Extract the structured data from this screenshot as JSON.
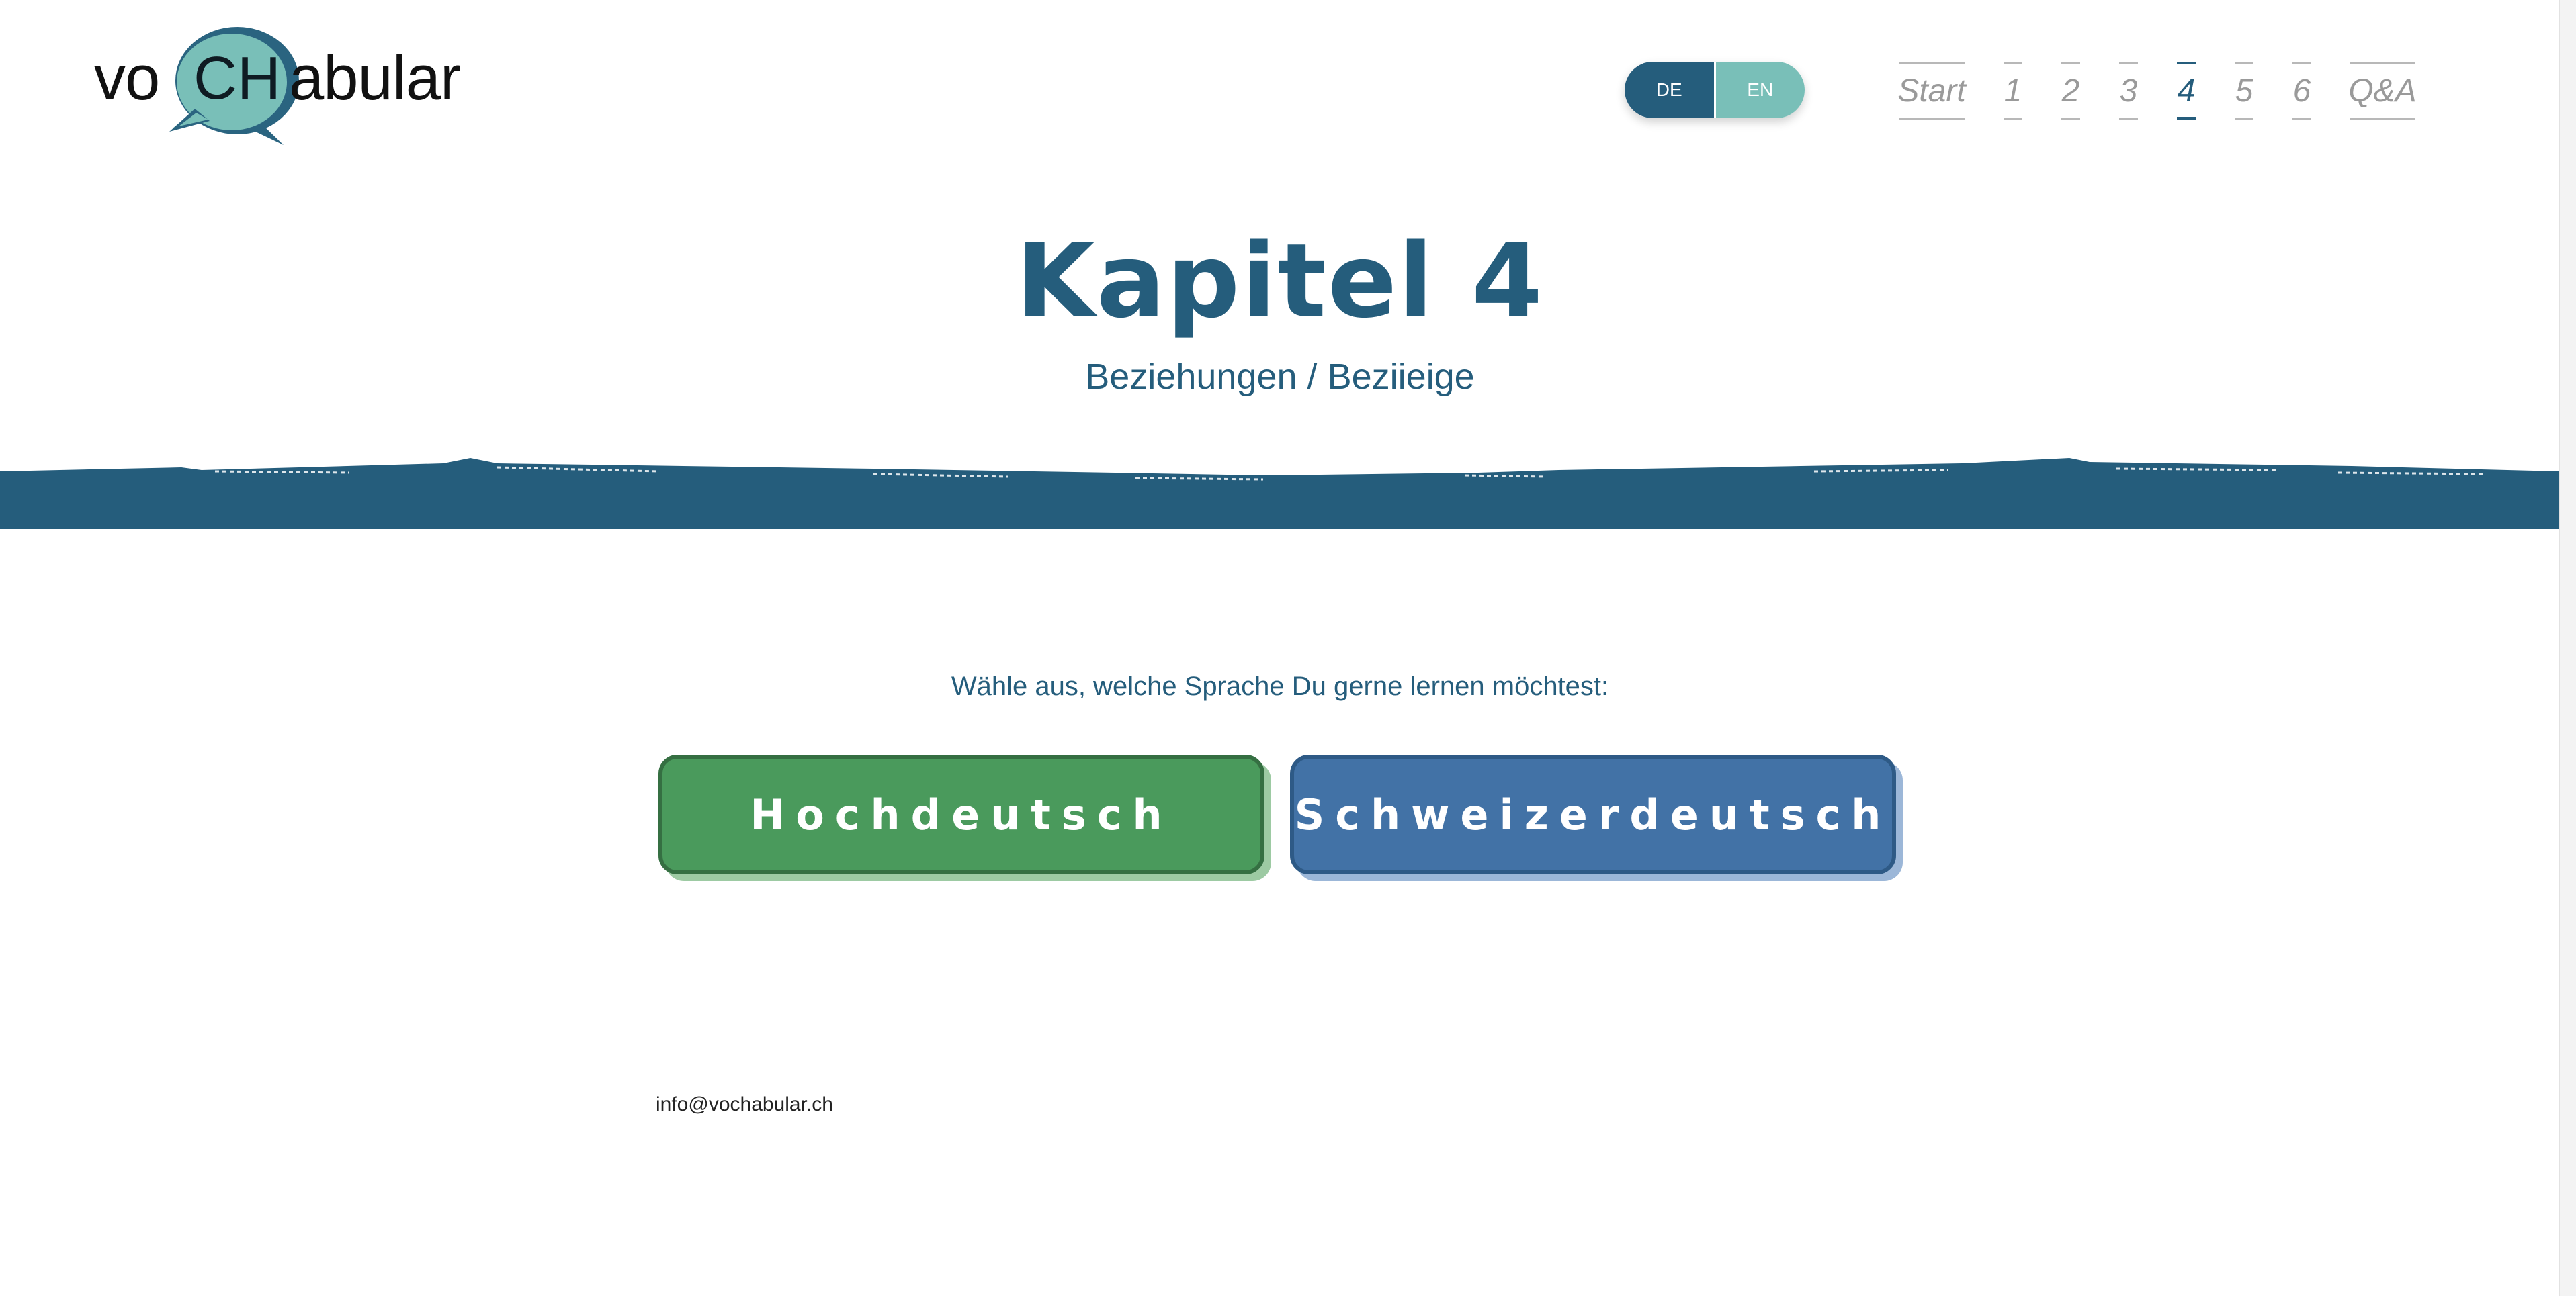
{
  "logo": {
    "left": "vo",
    "middle": "CH",
    "right": "abular"
  },
  "language_toggle": {
    "de": "DE",
    "en": "EN",
    "active": "DE"
  },
  "nav": {
    "items": [
      "Start",
      "1",
      "2",
      "3",
      "4",
      "5",
      "6",
      "Q&A"
    ],
    "active": "4"
  },
  "header": {
    "title": "Kapitel 4",
    "subtitle": "Beziehungen / Beziieige"
  },
  "prompt": "Wähle aus, welche Sprache Du gerne lernen möchtest:",
  "buttons": {
    "hochdeutsch": "Hochdeutsch",
    "schweizerdeutsch": "Schweizerdeutsch"
  },
  "footer": {
    "email": "info@vochabular.ch"
  },
  "colors": {
    "primary": "#255d7c",
    "teal": "#79bfb8",
    "green_button": "#4a9a5c",
    "blue_button": "#4272a6"
  }
}
